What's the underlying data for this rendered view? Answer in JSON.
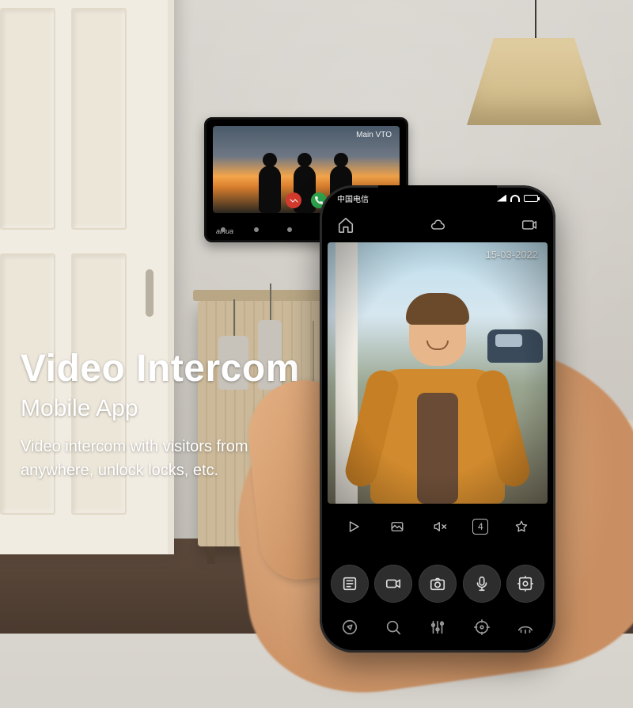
{
  "marketing": {
    "title": "Video Intercom",
    "subtitle": "Mobile App",
    "description": "Video intercom with visitors from anywhere, unlock locks, etc."
  },
  "wall_tablet": {
    "caller_label": "Main VTO",
    "brand": "alhua"
  },
  "phone": {
    "status_bar": {
      "carrier": "中国电信"
    },
    "feed": {
      "date_overlay": "15-03-2022"
    },
    "mini_controls": {
      "grid_count": "4"
    }
  }
}
